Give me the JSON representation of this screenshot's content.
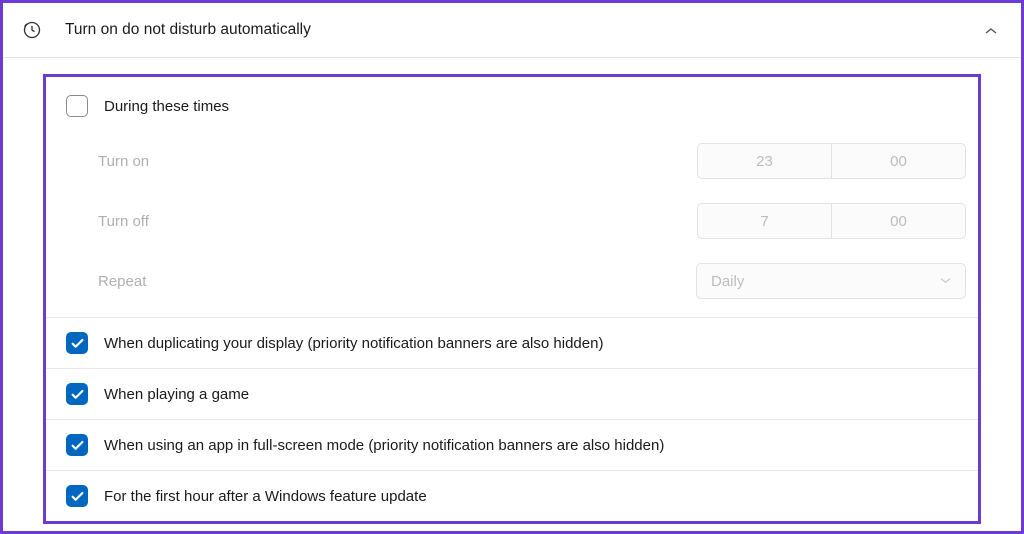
{
  "header": {
    "title": "Turn on do not disturb automatically"
  },
  "options": {
    "duringTimes": {
      "label": "During these times",
      "checked": false,
      "turnOnLabel": "Turn on",
      "turnOnHour": "23",
      "turnOnMin": "00",
      "turnOffLabel": "Turn off",
      "turnOffHour": "7",
      "turnOffMin": "00",
      "repeatLabel": "Repeat",
      "repeatValue": "Daily"
    },
    "duplicating": {
      "label": "When duplicating your display (priority notification banners are also hidden)",
      "checked": true
    },
    "gaming": {
      "label": "When playing a game",
      "checked": true
    },
    "fullscreen": {
      "label": "When using an app in full-screen mode (priority notification banners are also hidden)",
      "checked": true
    },
    "featureUpdate": {
      "label": "For the first hour after a Windows feature update",
      "checked": true
    }
  }
}
